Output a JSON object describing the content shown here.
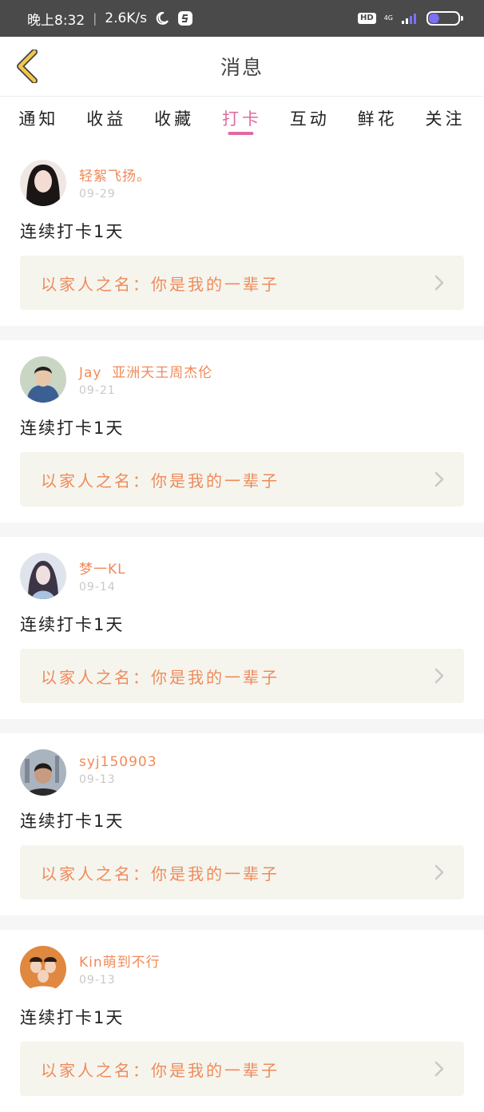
{
  "status_bar": {
    "time": "晚上8:32",
    "speed": "2.6K/s",
    "hd": "HD",
    "network": "4G",
    "battery_level": "33"
  },
  "header": {
    "title": "消息"
  },
  "tabs": [
    {
      "label": "通知"
    },
    {
      "label": "收益"
    },
    {
      "label": "收藏"
    },
    {
      "label": "打卡"
    },
    {
      "label": "互动"
    },
    {
      "label": "鲜花"
    },
    {
      "label": "关注"
    }
  ],
  "active_tab": "打卡",
  "posts": [
    {
      "username": "轻絮飞扬。",
      "date": "09-29",
      "text": "连续打卡1天",
      "link": "以家人之名：你是我的一辈子"
    },
    {
      "username": "Jay  亚洲天王周杰伦",
      "date": "09-21",
      "text": "连续打卡1天",
      "link": "以家人之名：你是我的一辈子"
    },
    {
      "username": "梦一KL",
      "date": "09-14",
      "text": "连续打卡1天",
      "link": "以家人之名：你是我的一辈子"
    },
    {
      "username": "syj150903",
      "date": "09-13",
      "text": "连续打卡1天",
      "link": "以家人之名：你是我的一辈子"
    },
    {
      "username": "Kin萌到不行",
      "date": "09-13",
      "text": "连续打卡1天",
      "link": "以家人之名：你是我的一辈子"
    }
  ],
  "colors": {
    "accent_pink": "#e06aa1",
    "username_orange": "#f08a5a",
    "back_arrow_yellow": "#f2c84b"
  }
}
